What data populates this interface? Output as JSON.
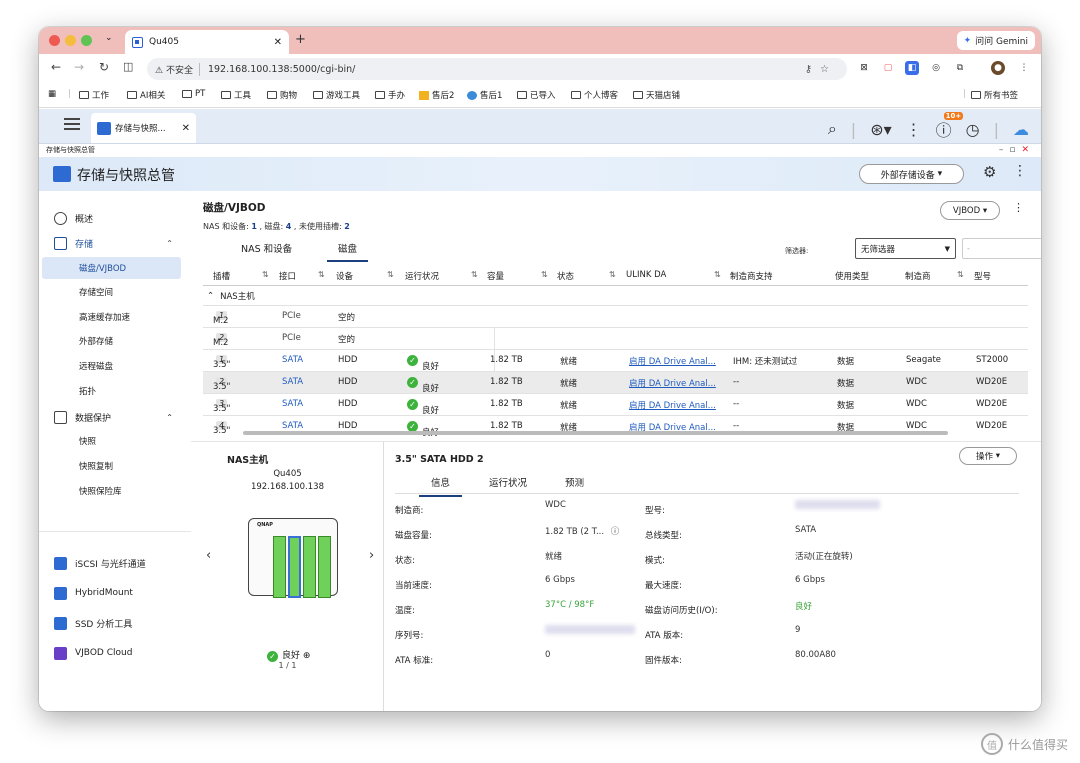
{
  "browser": {
    "tab_title": "Qu405",
    "new_tab": "+",
    "gemini_label": "问问 Gemini",
    "insecure_label": "不安全",
    "url": "192.168.100.138:5000/cgi-bin/",
    "bookmarks": [
      "工作",
      "AI相关",
      "PT",
      "工具",
      "购物",
      "游戏工具",
      "手办",
      "售后2",
      "售后1",
      "已导入",
      "个人博客",
      "天猫店铺"
    ],
    "all_bookmarks": "所有书签"
  },
  "qts": {
    "tab_label": "存储与快照...",
    "window_title": "存储与快照总管",
    "notification_count": "10+"
  },
  "app": {
    "title": "存储与快照总管",
    "external_button": "外部存储设备"
  },
  "sidebar": {
    "overview": "概述",
    "storage": "存储",
    "storage_items": [
      "磁盘/VJBOD",
      "存储空间",
      "高速缓存加速",
      "外部存储",
      "远程磁盘",
      "拓扑"
    ],
    "data_protection": "数据保护",
    "protection_items": [
      "快照",
      "快照复制",
      "快照保险库"
    ],
    "apps": [
      "iSCSI 与光纤通道",
      "HybridMount",
      "SSD 分析工具",
      "VJBOD Cloud"
    ]
  },
  "main": {
    "title": "磁盘/VJBOD",
    "summary_prefix": "NAS 和设备: ",
    "summary_nas": "1",
    "summary_mid": " , 磁盘: ",
    "summary_disks": "4",
    "summary_mid2": " , 未使用插槽: ",
    "summary_slots": "2",
    "vjbod_button": "VJBOD",
    "tabs": [
      "NAS 和设备",
      "磁盘"
    ],
    "filter_label": "筛选器:",
    "filter_value": "无筛选器",
    "filter2_value": "-"
  },
  "table": {
    "headers": [
      "插槽",
      "接口",
      "设备",
      "运行状况",
      "容量",
      "状态",
      "ULINK DA",
      "制造商支持",
      "使用类型",
      "制造商",
      "型号"
    ],
    "group": "NAS主机",
    "rows": [
      {
        "slot": "M.2",
        "num": "1",
        "iface": "PCIe",
        "device": "空的",
        "health": "",
        "cap": "",
        "status": "",
        "ulink": "",
        "support": "",
        "usage": "",
        "maker": "",
        "model": ""
      },
      {
        "slot": "M.2",
        "num": "2",
        "iface": "PCIe",
        "device": "空的",
        "health": "",
        "cap": "",
        "status": "",
        "ulink": "",
        "support": "",
        "usage": "",
        "maker": "",
        "model": ""
      },
      {
        "slot": "3.5\"",
        "num": "1",
        "iface": "SATA",
        "device": "HDD",
        "health": "良好",
        "cap": "1.82 TB",
        "status": "就绪",
        "ulink": "启用 DA Drive Anal...",
        "support": "IHM: 还未测试过",
        "usage": "数据",
        "maker": "Seagate",
        "model": "ST2000"
      },
      {
        "slot": "3.5\"",
        "num": "2",
        "iface": "SATA",
        "device": "HDD",
        "health": "良好",
        "cap": "1.82 TB",
        "status": "就绪",
        "ulink": "启用 DA Drive Anal...",
        "support": "--",
        "usage": "数据",
        "maker": "WDC",
        "model": "WD20E"
      },
      {
        "slot": "3.5\"",
        "num": "3",
        "iface": "SATA",
        "device": "HDD",
        "health": "良好",
        "cap": "1.82 TB",
        "status": "就绪",
        "ulink": "启用 DA Drive Anal...",
        "support": "--",
        "usage": "数据",
        "maker": "WDC",
        "model": "WD20E"
      },
      {
        "slot": "3.5\"",
        "num": "4",
        "iface": "SATA",
        "device": "HDD",
        "health": "良好",
        "cap": "1.82 TB",
        "status": "就绪",
        "ulink": "启用 DA Drive Anal...",
        "support": "--",
        "usage": "数据",
        "maker": "WDC",
        "model": "WD20E"
      }
    ]
  },
  "nas": {
    "title": "NAS主机",
    "name": "Qu405",
    "ip": "192.168.100.138",
    "logo": "QNAP",
    "status": "良好",
    "page": "1 / 1"
  },
  "detail": {
    "title": "3.5\" SATA HDD 2",
    "op_button": "操作",
    "tabs": [
      "信息",
      "运行状况",
      "预测"
    ],
    "left": [
      {
        "label": "制造商:",
        "value": "WDC"
      },
      {
        "label": "磁盘容量:",
        "value": "1.82 TB (2 T..."
      },
      {
        "label": "状态:",
        "value": "就绪"
      },
      {
        "label": "当前速度:",
        "value": "6 Gbps"
      },
      {
        "label": "温度:",
        "value": "37°C / 98°F"
      },
      {
        "label": "序列号:",
        "value": ""
      },
      {
        "label": "ATA 标准:",
        "value": "0"
      }
    ],
    "right": [
      {
        "label": "型号:",
        "value": ""
      },
      {
        "label": "总线类型:",
        "value": "SATA"
      },
      {
        "label": "模式:",
        "value": "活动(正在旋转)"
      },
      {
        "label": "最大速度:",
        "value": "6 Gbps"
      },
      {
        "label": "磁盘访问历史(I/O):",
        "value": "良好"
      },
      {
        "label": "ATA 版本:",
        "value": "9"
      },
      {
        "label": "固件版本:",
        "value": "80.00A80"
      }
    ]
  },
  "watermark": "什么值得买",
  "watermark_glyph": "值"
}
